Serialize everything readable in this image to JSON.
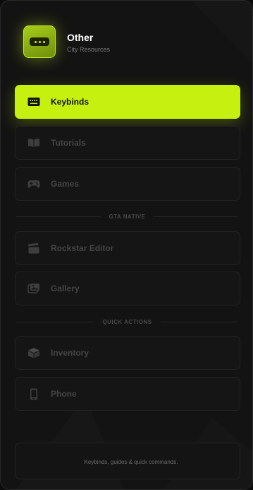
{
  "header": {
    "title": "Other",
    "subtitle": "City Resources"
  },
  "nav": {
    "keybinds": "Keybinds",
    "tutorials": "Tutorials",
    "games": "Games",
    "rockstar_editor": "Rockstar Editor",
    "gallery": "Gallery",
    "inventory": "Inventory",
    "phone": "Phone"
  },
  "sections": {
    "gta_native": "GTA NATIVE",
    "quick_actions": "QUICK ACTIONS"
  },
  "footer": {
    "text": "Keybinds, guides & quick commands."
  },
  "colors": {
    "accent": "#c6f00f",
    "panel_bg": "#131313",
    "item_bg": "#151515",
    "muted_text": "#454545"
  },
  "icons": {
    "app": "more-dots-icon",
    "keybinds": "keyboard-icon",
    "tutorials": "book-icon",
    "games": "gamepad-icon",
    "rockstar_editor": "clapperboard-icon",
    "gallery": "images-icon",
    "inventory": "box-icon",
    "phone": "phone-icon"
  }
}
